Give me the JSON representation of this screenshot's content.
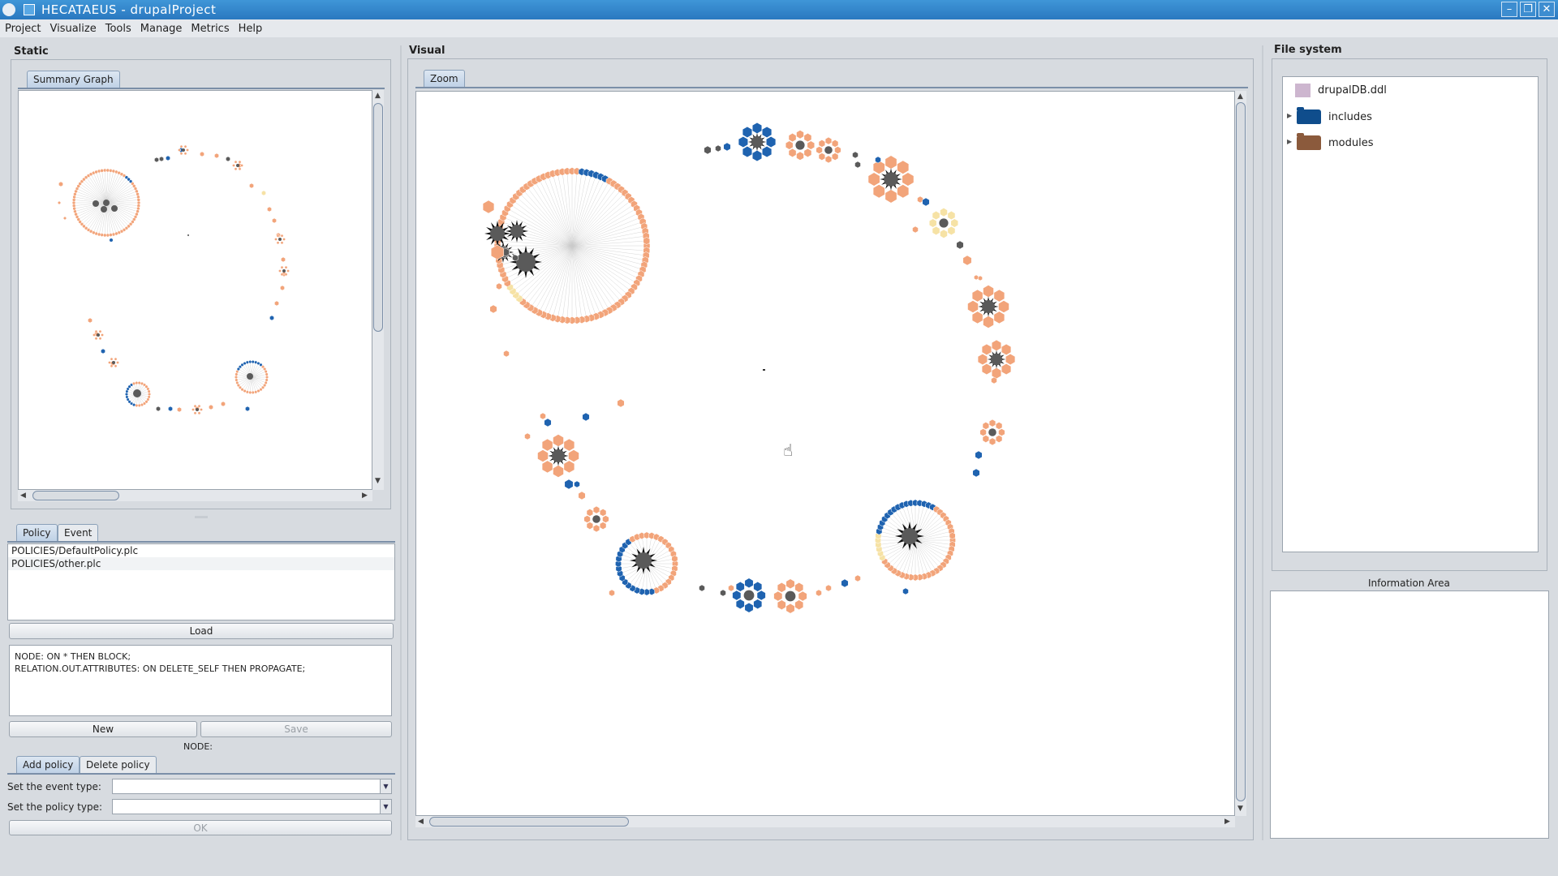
{
  "window": {
    "title": "HECATAEUS - drupalProject",
    "controls": [
      "–",
      "❐",
      "✕"
    ]
  },
  "menu": [
    "Project",
    "Visualize",
    "Tools",
    "Manage",
    "Metrics",
    "Help"
  ],
  "static_panel": {
    "label": "Static",
    "tab": "Summary Graph",
    "policy_tabs": [
      "Policy",
      "Event"
    ],
    "policy_files": [
      "POLICIES/DefaultPolicy.plc",
      "POLICIES/other.plc"
    ],
    "load_label": "Load",
    "policy_text": "NODE: ON * THEN BLOCK;\nRELATION.OUT.ATTRIBUTES: ON DELETE_SELF THEN PROPAGATE;",
    "new_label": "New",
    "save_label": "Save",
    "node_label": "NODE:",
    "action_tabs": [
      "Add policy",
      "Delete policy"
    ],
    "event_type_label": "Set the event type:",
    "policy_type_label": "Set the policy type:",
    "ok_label": "OK"
  },
  "visual_panel": {
    "label": "Visual",
    "tab": "Zoom"
  },
  "file_system": {
    "label": "File system",
    "items": [
      {
        "name": "drupalDB.ddl",
        "icon": "file-icon",
        "color": "#cdb6cf"
      },
      {
        "name": "includes",
        "icon": "folder-icon",
        "color": "#0f4d8c"
      },
      {
        "name": "modules",
        "icon": "folder-icon",
        "color": "#8b5a3c"
      }
    ],
    "info_label": "Information Area"
  },
  "colors": {
    "orange": "#f2a47a",
    "blue": "#1f63b0",
    "gray": "#5a5a5a",
    "yellow": "#f6e2a5"
  }
}
